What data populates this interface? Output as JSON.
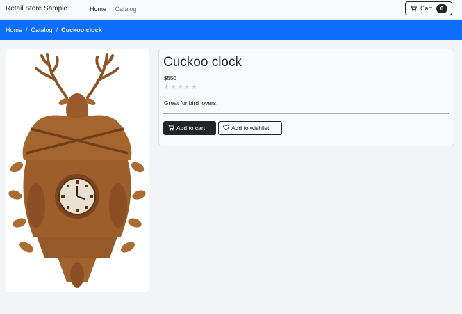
{
  "navbar": {
    "brand": "Retail Store Sample",
    "links": [
      "Home",
      "Catalog"
    ],
    "cart": {
      "label": "Cart",
      "count": "0",
      "icon": "cart-icon"
    }
  },
  "breadcrumb": {
    "items": [
      "Home",
      "Catalog",
      "Cuckoo clock"
    ],
    "separator": "/"
  },
  "product": {
    "title": "Cuckoo clock",
    "price": "$550",
    "rating": 0,
    "rating_max": 5,
    "description": "Great for bird lovers.",
    "add_to_cart": "Add to cart",
    "add_to_wishlist": "Add to wishlist",
    "image": "carved-wooden-cuckoo-clock-with-antlers"
  },
  "colors": {
    "accent": "#0d6efd",
    "dark": "#212529",
    "wood": "#9a5b2a"
  }
}
